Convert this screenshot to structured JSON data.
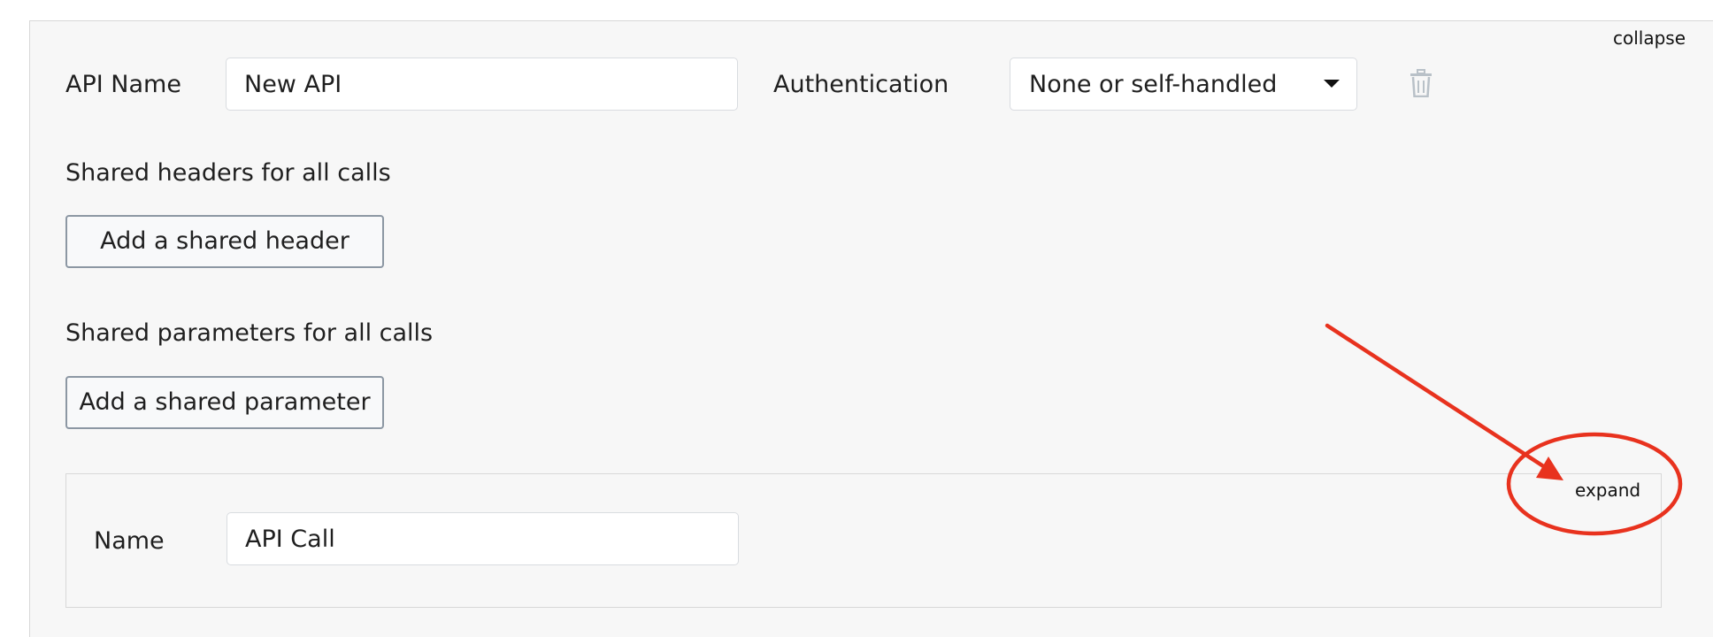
{
  "api": {
    "collapse_label": "collapse",
    "name_label": "API Name",
    "name_value": "New API",
    "auth_label": "Authentication",
    "auth_value": "None or self-handled",
    "delete_icon": "trash-icon"
  },
  "shared_headers": {
    "heading": "Shared headers for all calls",
    "add_button": "Add a shared header"
  },
  "shared_parameters": {
    "heading": "Shared parameters for all calls",
    "add_button": "Add a shared parameter"
  },
  "call": {
    "expand_label": "expand",
    "name_label": "Name",
    "name_value": "API Call"
  },
  "annotation": {
    "color": "#e8321e"
  }
}
